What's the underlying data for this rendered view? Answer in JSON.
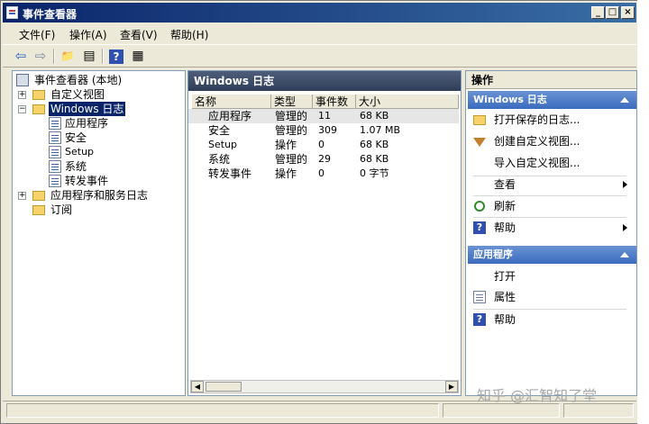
{
  "window": {
    "title": "事件查看器",
    "minimize": "_",
    "restore": "□",
    "close": "×"
  },
  "menu": [
    "文件(F)",
    "操作(A)",
    "查看(V)",
    "帮助(H)"
  ],
  "toolbar": {
    "back": "⇦",
    "forward": "⇨",
    "up": "📁",
    "panel": "▤",
    "help": "?",
    "panel2": "▦"
  },
  "tree": {
    "root": "事件查看器 (本地)",
    "custom_views": "自定义视图",
    "windows_logs": "Windows 日志",
    "application": "应用程序",
    "security": "安全",
    "setup": "Setup",
    "system": "系统",
    "forwarded": "转发事件",
    "app_services": "应用程序和服务日志",
    "subscriptions": "订阅",
    "expand_plus": "+",
    "expand_minus": "−"
  },
  "center": {
    "title": "Windows 日志",
    "columns": [
      "名称",
      "类型",
      "事件数",
      "大小"
    ],
    "rows": [
      {
        "name": "应用程序",
        "type": "管理的",
        "count": "11",
        "size": "68 KB"
      },
      {
        "name": "安全",
        "type": "管理的",
        "count": "309",
        "size": "1.07 MB"
      },
      {
        "name": "Setup",
        "type": "操作",
        "count": "0",
        "size": "68 KB"
      },
      {
        "name": "系统",
        "type": "管理的",
        "count": "29",
        "size": "68 KB"
      },
      {
        "name": "转发事件",
        "type": "操作",
        "count": "0",
        "size": "0 字节"
      }
    ],
    "scroll_left": "◀",
    "scroll_right": "▶"
  },
  "actions": {
    "title": "操作",
    "section1": "Windows 日志",
    "section1_items": [
      "打开保存的日志...",
      "创建自定义视图...",
      "导入自定义视图...",
      "查看",
      "刷新",
      "帮助"
    ],
    "section2": "应用程序",
    "section2_items": [
      "打开",
      "属性",
      "帮助"
    ],
    "help_glyph": "?"
  },
  "watermark": "知乎 @汇智知了堂"
}
